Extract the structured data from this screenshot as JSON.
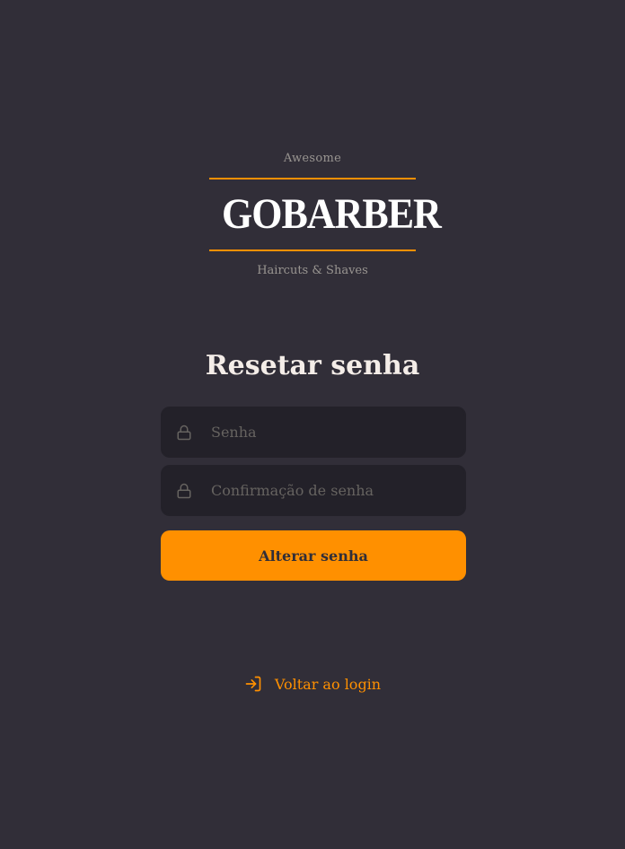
{
  "logo": {
    "top_text": "Awesome",
    "wordmark": "GOBARBER",
    "bottom_text": "Haircuts & Shaves"
  },
  "form": {
    "title": "Resetar senha",
    "password": {
      "placeholder": "Senha",
      "value": "",
      "icon": "lock-icon"
    },
    "password_confirmation": {
      "placeholder": "Confirmação de senha",
      "value": "",
      "icon": "lock-icon"
    },
    "submit_label": "Alterar senha"
  },
  "back_link": {
    "label": "Voltar ao login",
    "icon": "log-in-icon"
  },
  "colors": {
    "background": "#312e38",
    "input_background": "#232129",
    "accent": "#ff9000",
    "text": "#f4ede8",
    "placeholder": "#666360",
    "muted": "#999591"
  }
}
